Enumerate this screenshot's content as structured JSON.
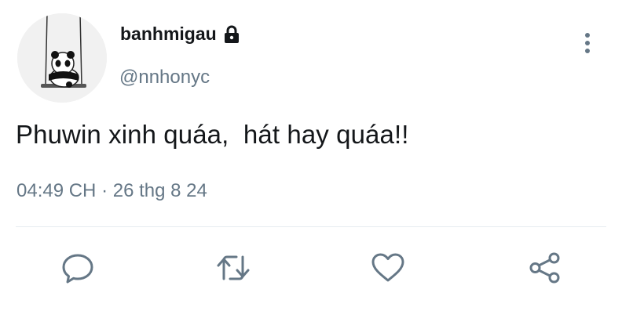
{
  "tweet": {
    "display_name": "banhmigau",
    "handle": "@nnhonyc",
    "text": "Phuwin xinh quáa,  hát hay quáa!!",
    "time": "04:49 CH",
    "separator": "·",
    "date": "26 thg 8 24"
  },
  "icons": {
    "avatar": "avatar-image",
    "lock": "lock-icon",
    "more": "more-vertical-icon",
    "reply": "reply-icon",
    "retweet": "retweet-icon",
    "like": "heart-icon",
    "share": "share-icon"
  },
  "colors": {
    "text": "#14171a",
    "secondary": "#657786",
    "icon": "#657786",
    "divider": "#e6ecf0"
  }
}
